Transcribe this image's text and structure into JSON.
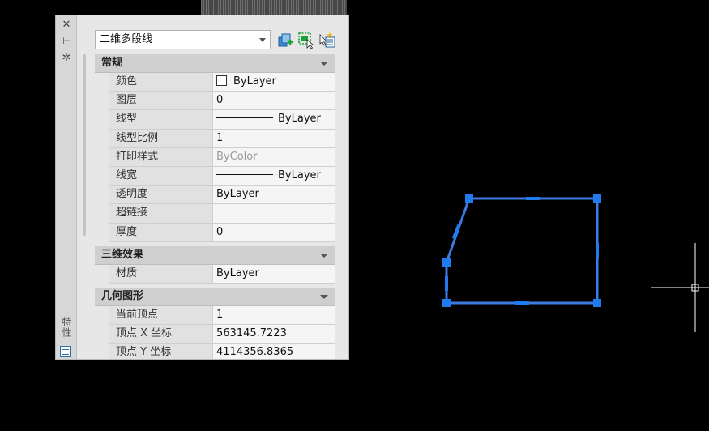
{
  "panel": {
    "side_title": "特性",
    "side_icons": [
      "close-icon",
      "pin-icon",
      "settings-icon"
    ],
    "header": {
      "object_type": "二维多段线",
      "toolbar_icons": [
        "quick-select-icon",
        "select-objects-icon",
        "toggle-pickadd-icon"
      ]
    },
    "sections": {
      "general": {
        "title": "常规",
        "rows": [
          {
            "label": "颜色",
            "value": "ByLayer"
          },
          {
            "label": "图层",
            "value": "0"
          },
          {
            "label": "线型",
            "value": "ByLayer"
          },
          {
            "label": "线型比例",
            "value": "1"
          },
          {
            "label": "打印样式",
            "value": "ByColor"
          },
          {
            "label": "线宽",
            "value": "ByLayer"
          },
          {
            "label": "透明度",
            "value": "ByLayer"
          },
          {
            "label": "超链接",
            "value": ""
          },
          {
            "label": "厚度",
            "value": "0"
          }
        ]
      },
      "three_d": {
        "title": "三维效果",
        "rows": [
          {
            "label": "材质",
            "value": "ByLayer"
          }
        ]
      },
      "geometry": {
        "title": "几何图形",
        "rows": [
          {
            "label": "当前顶点",
            "value": "1"
          },
          {
            "label": "顶点 X 坐标",
            "value": "563145.7223"
          },
          {
            "label": "顶点 Y 坐标",
            "value": "4114356.8365"
          }
        ]
      }
    }
  },
  "canvas": {
    "polyline_color": "#3d7be3",
    "grip_color": "#1e7cf0",
    "crosshair_color": "#ffffff"
  }
}
